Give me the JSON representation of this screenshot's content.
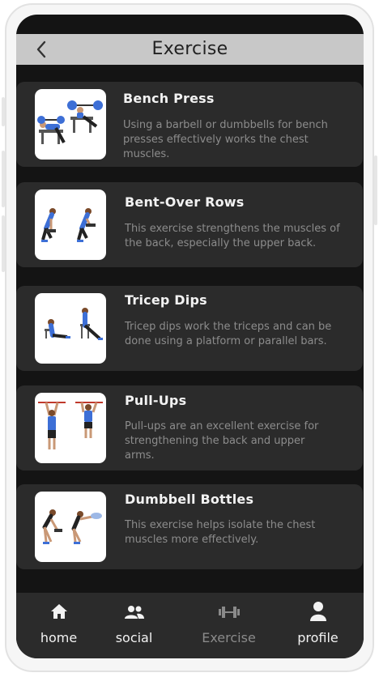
{
  "header": {
    "title": "Exercise",
    "back_icon": "chevron-left-icon"
  },
  "exercises": [
    {
      "name": "Bench Press",
      "description": "Using a barbell or dumbbells for bench presses effectively works the chest muscles."
    },
    {
      "name": "Bent-Over Rows",
      "description": "This exercise strengthens the muscles of the back, especially the upper back."
    },
    {
      "name": "Tricep Dips",
      "description": "Tricep dips work the triceps and can be done using a platform or parallel bars."
    },
    {
      "name": "Pull-Ups",
      "description": "Pull-ups are an excellent exercise for strengthening the back and upper arms."
    },
    {
      "name": "Dumbbell Bottles",
      "description": "This exercise helps isolate the chest muscles more effectively."
    }
  ],
  "nav": [
    {
      "label": "home",
      "icon": "home-icon",
      "active": false
    },
    {
      "label": "social",
      "icon": "people-icon",
      "active": false
    },
    {
      "label": "Exercise",
      "icon": "dumbbell-icon",
      "active": true
    },
    {
      "label": "profile",
      "icon": "person-icon",
      "active": false
    }
  ],
  "colors": {
    "screen_bg": "#141414",
    "card_bg": "#2b2b2b",
    "header_bg": "#c8c8c8",
    "accent_blue": "#3d6fd6",
    "inactive_nav": "#8a8a8a"
  }
}
